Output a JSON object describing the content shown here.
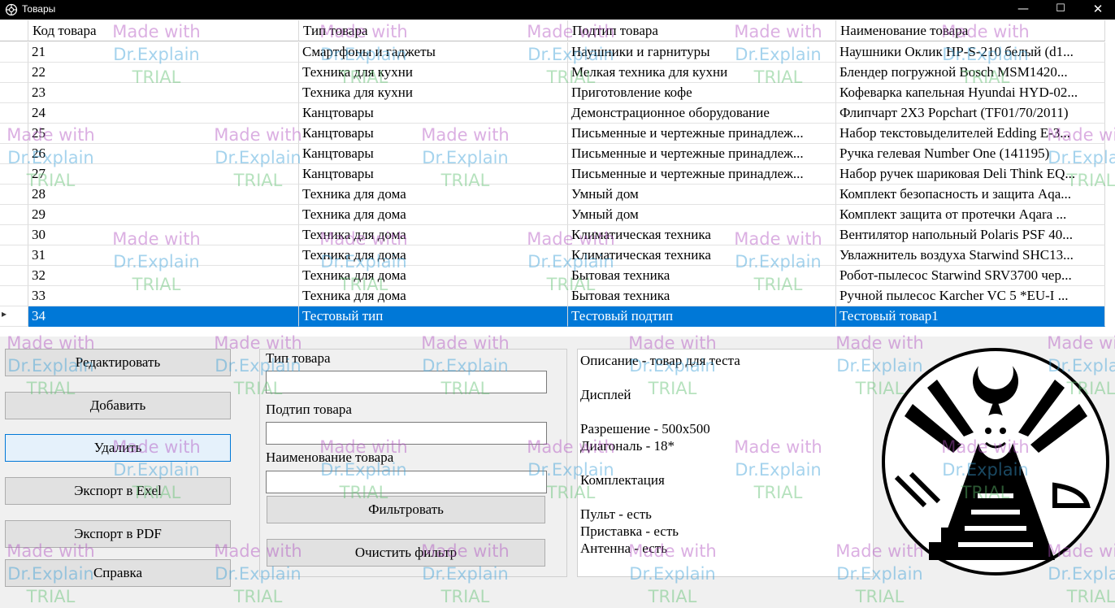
{
  "window": {
    "title": "Товары",
    "minimize_glyph": "—",
    "maximize_glyph": "☐",
    "close_glyph": "✕"
  },
  "grid": {
    "columns": [
      "Код товара",
      "Тип товара",
      "Подтип товара",
      "Наименование товара"
    ],
    "rows": [
      {
        "id": "21",
        "type": "Смартфоны и гаджеты",
        "subtype": "Наушники и гарнитуры",
        "name": "Наушники Оклик HP-S-210 белый (d1..."
      },
      {
        "id": "22",
        "type": "Техника для кухни",
        "subtype": "Мелкая техника для кухни",
        "name": "Блендер погружной Bosch MSM1420..."
      },
      {
        "id": "23",
        "type": "Техника для кухни",
        "subtype": "Приготовление кофе",
        "name": "Кофеварка капельная Hyundai HYD-02..."
      },
      {
        "id": "24",
        "type": "Канцтовары",
        "subtype": "Демонстрационное оборудование",
        "name": "Флипчарт 2X3 Popchart (TF01/70/2011)"
      },
      {
        "id": "25",
        "type": "Канцтовары",
        "subtype": "Письменные и чертежные принадлеж...",
        "name": "Набор текстовыделителей Edding E-3..."
      },
      {
        "id": "26",
        "type": "Канцтовары",
        "subtype": "Письменные и чертежные принадлеж...",
        "name": "Ручка гелевая Number One (141195)"
      },
      {
        "id": "27",
        "type": "Канцтовары",
        "subtype": "Письменные и чертежные принадлеж...",
        "name": "Набор ручек шариковая Deli Think EQ..."
      },
      {
        "id": "28",
        "type": "Техника для дома",
        "subtype": "Умный дом",
        "name": "Комплект безопасность и защита Aqa..."
      },
      {
        "id": "29",
        "type": "Техника для дома",
        "subtype": "Умный дом",
        "name": "Комплект защита от протечки Aqara ..."
      },
      {
        "id": "30",
        "type": "Техника для дома",
        "subtype": "Климатическая техника",
        "name": "Вентилятор напольный Polaris PSF 40..."
      },
      {
        "id": "31",
        "type": "Техника для дома",
        "subtype": "Климатическая техника",
        "name": "Увлажнитель воздуха Starwind SHC13..."
      },
      {
        "id": "32",
        "type": "Техника для дома",
        "subtype": "Бытовая техника",
        "name": "Робот-пылесос Starwind SRV3700 чер..."
      },
      {
        "id": "33",
        "type": "Техника для дома",
        "subtype": "Бытовая техника",
        "name": "Ручной пылесос Karcher VC 5 *EU-I ..."
      },
      {
        "id": "34",
        "type": "Тестовый тип",
        "subtype": "Тестовый подтип",
        "name": "Тестовый товар1",
        "selected": true
      }
    ]
  },
  "actions": {
    "edit": "Редактировать",
    "add": "Добавить",
    "delete": "Удалить",
    "export_excel": "Экспорт в Exel",
    "export_pdf": "Экспорт в PDF",
    "help": "Справка"
  },
  "filter": {
    "type_label": "Тип товара",
    "type_value": "",
    "subtype_label": "Подтип товара",
    "subtype_value": "",
    "name_label": "Наименование товара",
    "name_value": "",
    "filter_button": "Фильтровать",
    "clear_button": "Очистить фильтр"
  },
  "description": {
    "lines": [
      "Описание - товар для теста",
      "",
      "Дисплей",
      "",
      "Разрешение - 500x500",
      "Диагональ - 18*",
      "",
      "Комплектация",
      "",
      "Пульт - есть",
      "Приставка - есть",
      "Антенна - есть"
    ]
  },
  "watermark": {
    "line1": "Made with",
    "line2": "Dr.Explain",
    "line3": "TRIAL"
  },
  "colors": {
    "selection": "#0078d7",
    "titlebar": "#000000",
    "button_face": "#e1e1e1",
    "focus_border": "#0078d7"
  }
}
